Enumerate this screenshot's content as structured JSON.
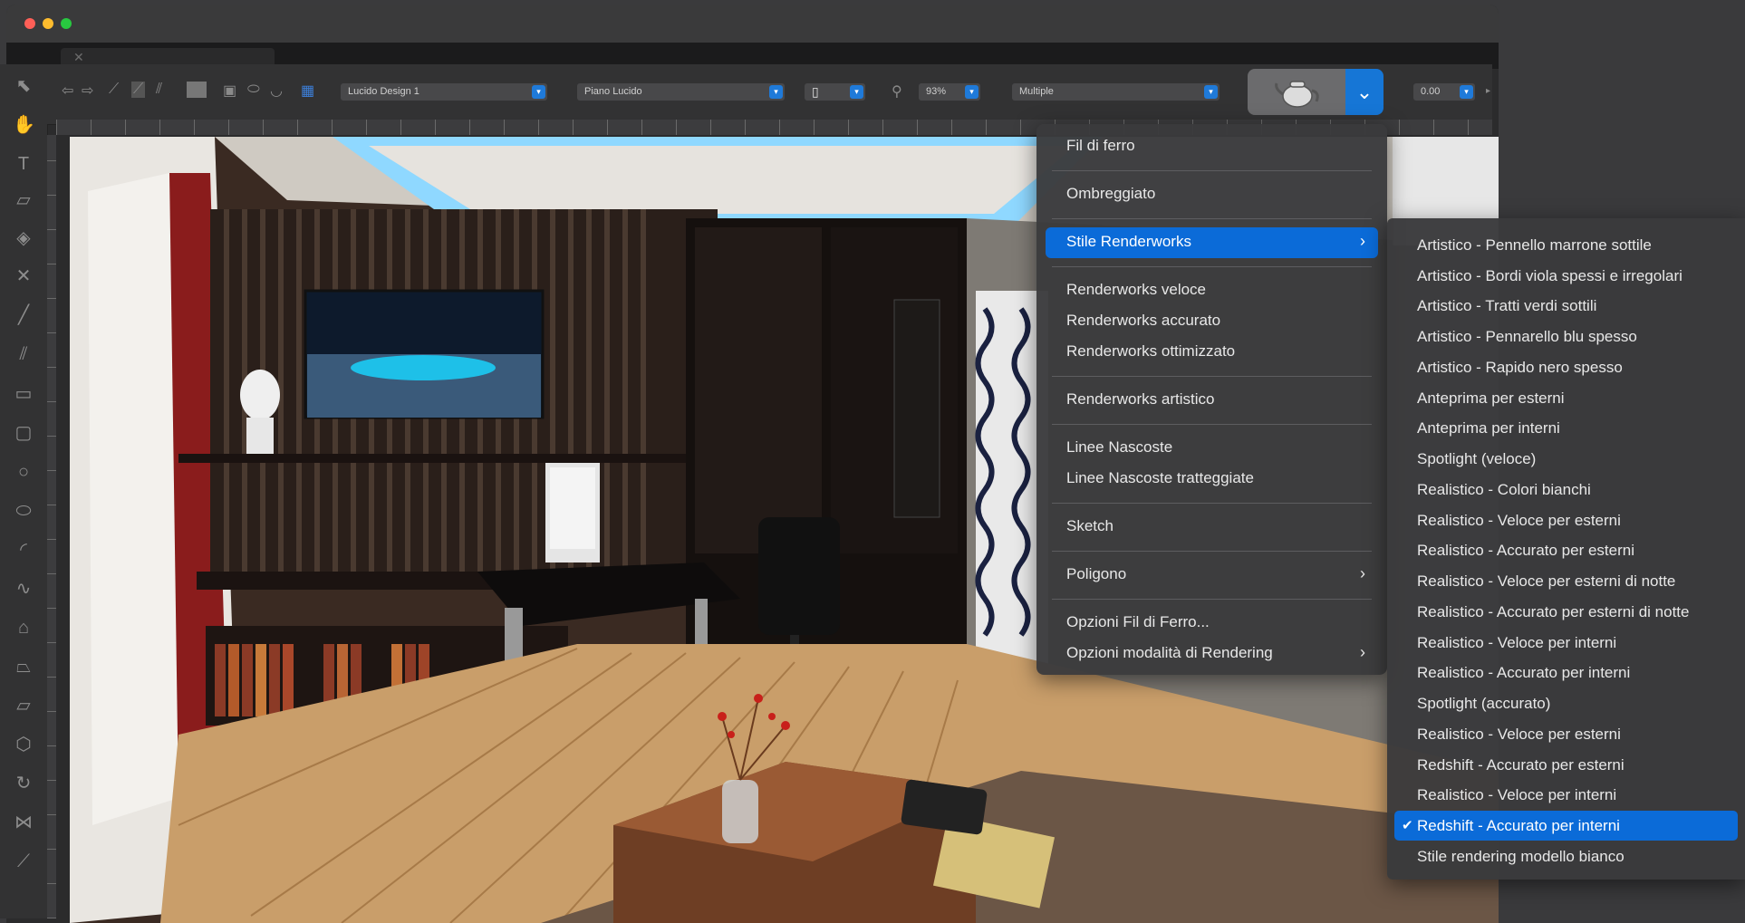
{
  "toolbar": {
    "class_dropdown": "Lucido Design 1",
    "layer_dropdown": "Piano Lucido",
    "zoom": "93%",
    "view_dropdown": "Multiple",
    "value_field": "0.00"
  },
  "render_menu": {
    "items": [
      {
        "label": "Fil di ferro"
      },
      {
        "label": "Ombreggiato"
      },
      {
        "label": "Stile Renderworks"
      },
      {
        "label": "Renderworks veloce"
      },
      {
        "label": "Renderworks accurato"
      },
      {
        "label": "Renderworks ottimizzato"
      },
      {
        "label": "Renderworks artistico"
      },
      {
        "label": "Linee Nascoste"
      },
      {
        "label": "Linee Nascoste tratteggiate"
      },
      {
        "label": "Sketch"
      },
      {
        "label": "Poligono"
      },
      {
        "label": "Opzioni Fil di Ferro..."
      },
      {
        "label": "Opzioni modalità di Rendering"
      }
    ]
  },
  "styles_submenu": {
    "items": [
      {
        "label": "Artistico - Pennello marrone sottile"
      },
      {
        "label": "Artistico - Bordi viola spessi e irregolari"
      },
      {
        "label": "Artistico - Tratti verdi sottili"
      },
      {
        "label": "Artistico - Pennarello blu spesso"
      },
      {
        "label": "Artistico - Rapido nero spesso"
      },
      {
        "label": "Anteprima per esterni"
      },
      {
        "label": "Anteprima per interni"
      },
      {
        "label": "Spotlight (veloce)"
      },
      {
        "label": "Realistico - Colori bianchi"
      },
      {
        "label": "Realistico - Veloce per esterni"
      },
      {
        "label": "Realistico - Accurato per esterni"
      },
      {
        "label": "Realistico - Veloce per esterni di notte"
      },
      {
        "label": "Realistico - Accurato per esterni di notte"
      },
      {
        "label": "Realistico - Veloce per interni"
      },
      {
        "label": "Realistico - Accurato per interni"
      },
      {
        "label": "Spotlight (accurato)"
      },
      {
        "label": "Realistico - Veloce per esterni"
      },
      {
        "label": "Redshift - Accurato per esterni"
      },
      {
        "label": "Realistico - Veloce per interni"
      },
      {
        "label": "Redshift - Accurato per interni"
      },
      {
        "label": "Stile rendering modello bianco"
      }
    ],
    "selected_check": "✔"
  },
  "colors": {
    "accent": "#0b6bd8",
    "menu_bg": "#3a3a3c",
    "window_bg": "#2b2b2c"
  }
}
